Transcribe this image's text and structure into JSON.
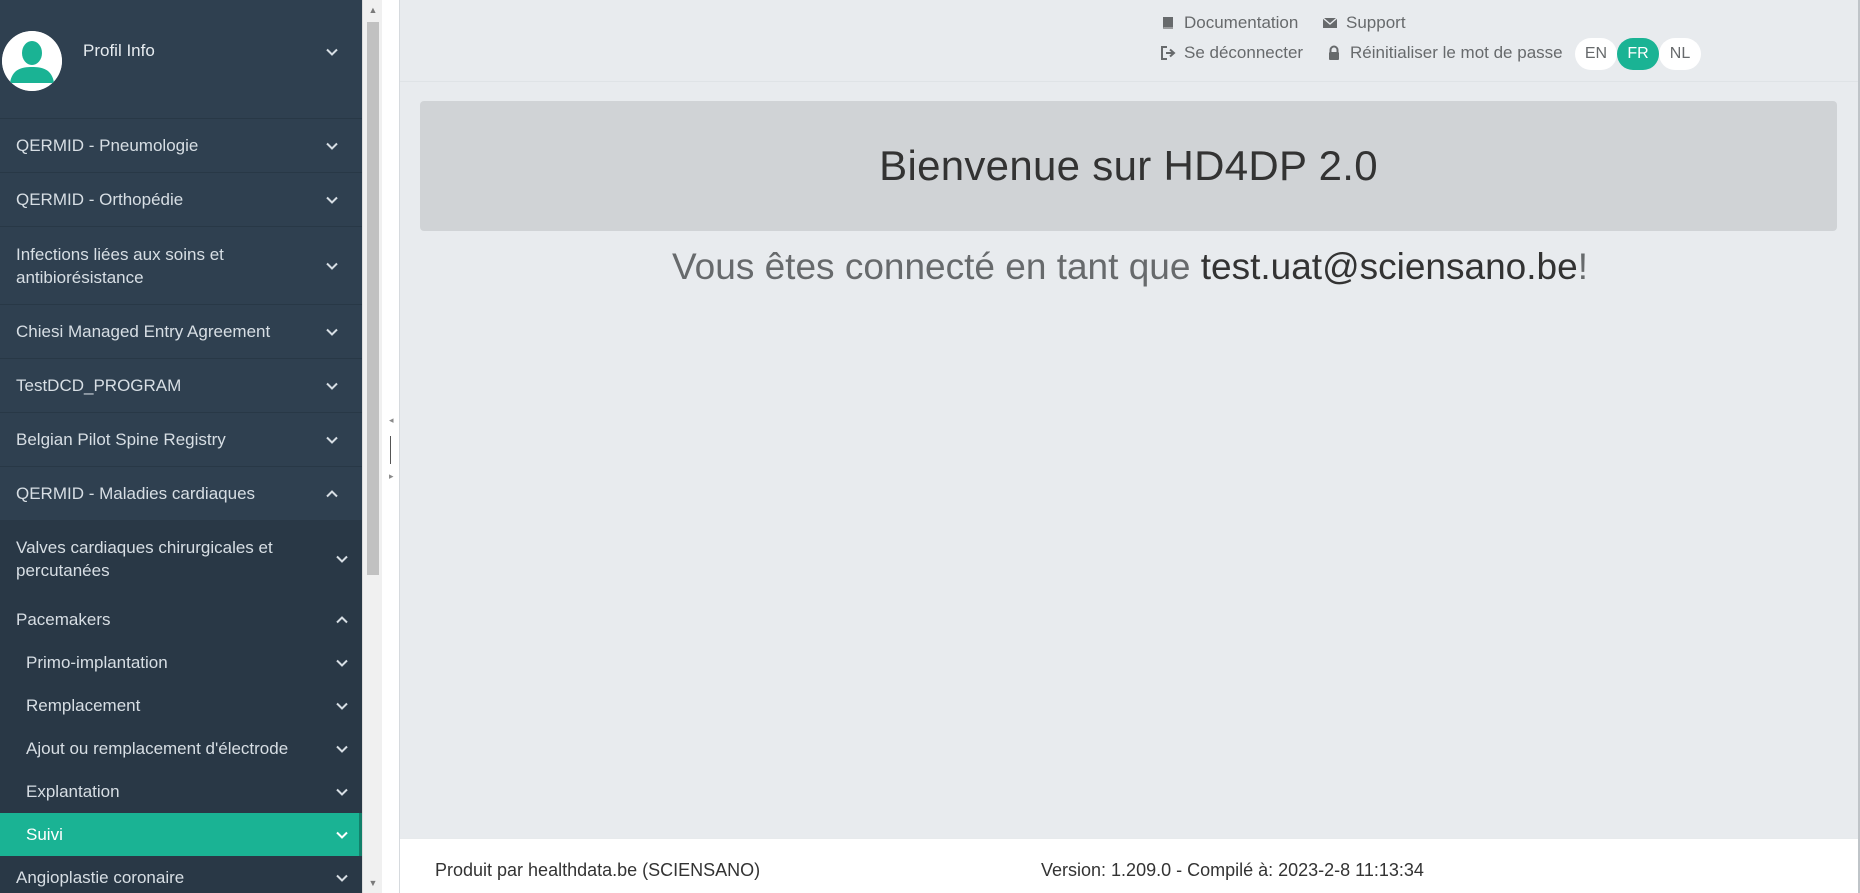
{
  "sidebar": {
    "profile": {
      "label": "Profil Info"
    },
    "items": [
      {
        "label": "QERMID - Pneumologie"
      },
      {
        "label": "QERMID - Orthopédie"
      },
      {
        "label": "Infections liées aux soins et antibiorésistance"
      },
      {
        "label": "Chiesi Managed Entry Agreement"
      },
      {
        "label": "TestDCD_PROGRAM"
      },
      {
        "label": "Belgian Pilot Spine Registry"
      },
      {
        "label": "QERMID - Maladies cardiaques"
      }
    ],
    "sub_items": [
      {
        "label": "Valves cardiaques chirurgicales et percutanées"
      },
      {
        "label": "Pacemakers"
      },
      {
        "label": "Primo-implantation"
      },
      {
        "label": "Remplacement"
      },
      {
        "label": "Ajout ou remplacement d'électrode"
      },
      {
        "label": "Explantation"
      },
      {
        "label": "Suivi"
      },
      {
        "label": "Angioplastie coronaire"
      }
    ]
  },
  "topbar": {
    "documentation": "Documentation",
    "support": "Support",
    "logout": "Se déconnecter",
    "reset_password": "Réinitialiser le mot de passe",
    "languages": [
      "EN",
      "FR",
      "NL"
    ],
    "active_language": "FR"
  },
  "main": {
    "welcome_title": "Bienvenue sur HD4DP 2.0",
    "connected_prefix": "Vous êtes connecté en tant que ",
    "connected_email": "test.uat@sciensano.be",
    "connected_suffix": "!"
  },
  "footer": {
    "produced_by": "Produit par healthdata.be (SCIENSANO)",
    "version": "Version: 1.209.0  -  Compilé à: 2023-2-8 11:13:34"
  },
  "colors": {
    "sidebar_bg": "#2f4050",
    "accent": "#1ab394",
    "main_bg": "#e8ebee",
    "welcome_box": "#d0d3d6"
  }
}
